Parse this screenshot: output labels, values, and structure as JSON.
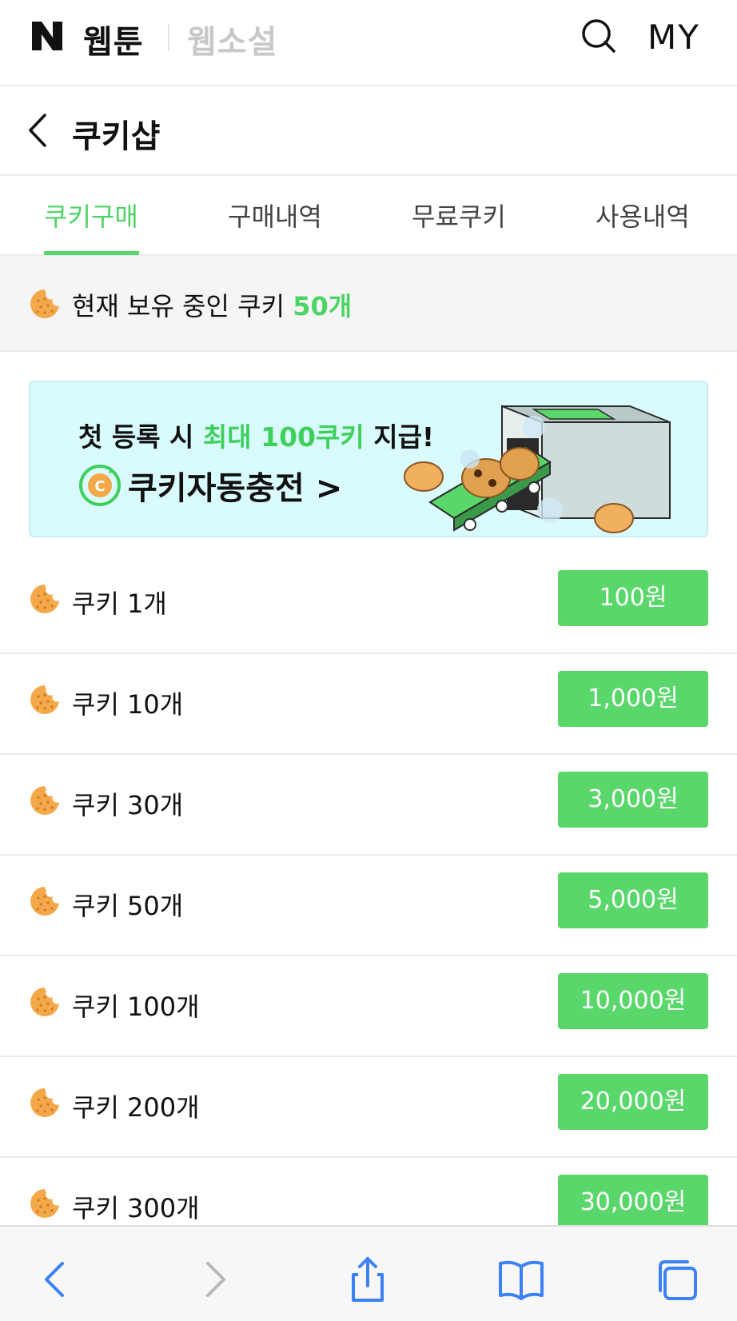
{
  "header": {
    "logo": "N",
    "nav_webtoon": "웹툰",
    "nav_novel": "웹소설",
    "my_label": "MY"
  },
  "subheader": {
    "title": "쿠키샵"
  },
  "tabs": [
    {
      "label": "쿠키구매",
      "active": true
    },
    {
      "label": "구매내역",
      "active": false
    },
    {
      "label": "무료쿠키",
      "active": false
    },
    {
      "label": "사용내역",
      "active": false
    }
  ],
  "balance": {
    "prefix": "현재 보유 중인 쿠키 ",
    "count": "50개"
  },
  "banner": {
    "line1_a": "첫 등록 시 ",
    "line1_highlight": "최대 100쿠키",
    "line1_b": " 지급!",
    "line2": "쿠키자동충전 >"
  },
  "products": [
    {
      "label": "쿠키 1개",
      "price": "100원"
    },
    {
      "label": "쿠키 10개",
      "price": "1,000원"
    },
    {
      "label": "쿠키 30개",
      "price": "3,000원"
    },
    {
      "label": "쿠키 50개",
      "price": "5,000원"
    },
    {
      "label": "쿠키 100개",
      "price": "10,000원"
    },
    {
      "label": "쿠키 200개",
      "price": "20,000원"
    },
    {
      "label": "쿠키 300개",
      "price": "30,000원"
    }
  ],
  "colors": {
    "accent": "#5ad76a",
    "cookie": "#f4a84a",
    "browser_icon": "#3b82f6"
  },
  "icons": {
    "search": "search-icon",
    "back": "chevron-left-icon",
    "cookie": "cookie-icon"
  }
}
